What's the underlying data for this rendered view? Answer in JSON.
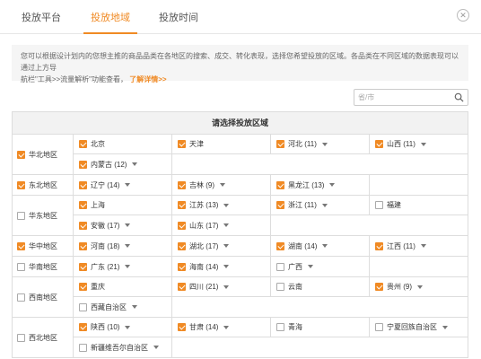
{
  "tabs": [
    {
      "label": "投放平台"
    },
    {
      "label": "投放地域"
    },
    {
      "label": "投放时间"
    }
  ],
  "notice": {
    "line1": "您可以根据设计划内的您想主推的商品品类在各地区的搜索、成交、转化表现，选择您希望投放的区域。各品类在不同区域的数据表现可以通过上方导",
    "line2": "航栏\"工具>>流量解析\"功能查看，",
    "link": "了解详情>>"
  },
  "search": {
    "placeholder": "省/市"
  },
  "table": {
    "header": "请选择投放区域",
    "regions": [
      {
        "name": "华北地区",
        "checked": true,
        "provinces": [
          {
            "label": "北京",
            "checked": true
          },
          {
            "label": "天津",
            "checked": true
          },
          {
            "label": "河北 (11)",
            "checked": true
          },
          {
            "label": "山西 (11)",
            "checked": true
          },
          {
            "label": "内蒙古 (12)",
            "checked": true
          }
        ]
      },
      {
        "name": "东北地区",
        "checked": true,
        "provinces": [
          {
            "label": "辽宁 (14)",
            "checked": true
          },
          {
            "label": "吉林 (9)",
            "checked": true
          },
          {
            "label": "黑龙江 (13)",
            "checked": true
          }
        ]
      },
      {
        "name": "华东地区",
        "checked": false,
        "provinces": [
          {
            "label": "上海",
            "checked": true
          },
          {
            "label": "江苏 (13)",
            "checked": true
          },
          {
            "label": "浙江 (11)",
            "checked": true
          },
          {
            "label": "福建",
            "checked": false
          },
          {
            "label": "安徽 (17)",
            "checked": true
          },
          {
            "label": "山东 (17)",
            "checked": true
          }
        ]
      },
      {
        "name": "华中地区",
        "checked": true,
        "provinces": [
          {
            "label": "河南 (18)",
            "checked": true
          },
          {
            "label": "湖北 (17)",
            "checked": true
          },
          {
            "label": "湖南 (14)",
            "checked": true
          },
          {
            "label": "江西 (11)",
            "checked": true
          }
        ]
      },
      {
        "name": "华南地区",
        "checked": false,
        "provinces": [
          {
            "label": "广东 (21)",
            "checked": true
          },
          {
            "label": "海南 (14)",
            "checked": true
          },
          {
            "label": "广西",
            "checked": false
          }
        ]
      },
      {
        "name": "西南地区",
        "checked": false,
        "provinces": [
          {
            "label": "重庆",
            "checked": true
          },
          {
            "label": "四川 (21)",
            "checked": true
          },
          {
            "label": "云南",
            "checked": false
          },
          {
            "label": "贵州 (9)",
            "checked": true
          },
          {
            "label": "西藏自治区",
            "checked": false
          }
        ]
      },
      {
        "name": "西北地区",
        "checked": false,
        "provinces": [
          {
            "label": "陕西 (10)",
            "checked": true
          },
          {
            "label": "甘肃 (14)",
            "checked": true
          },
          {
            "label": "青海",
            "checked": false
          },
          {
            "label": "宁夏回族自治区",
            "checked": false
          },
          {
            "label": "新疆维吾尔自治区",
            "checked": false
          }
        ]
      }
    ]
  },
  "colors": {
    "accent": "#f08a24"
  }
}
